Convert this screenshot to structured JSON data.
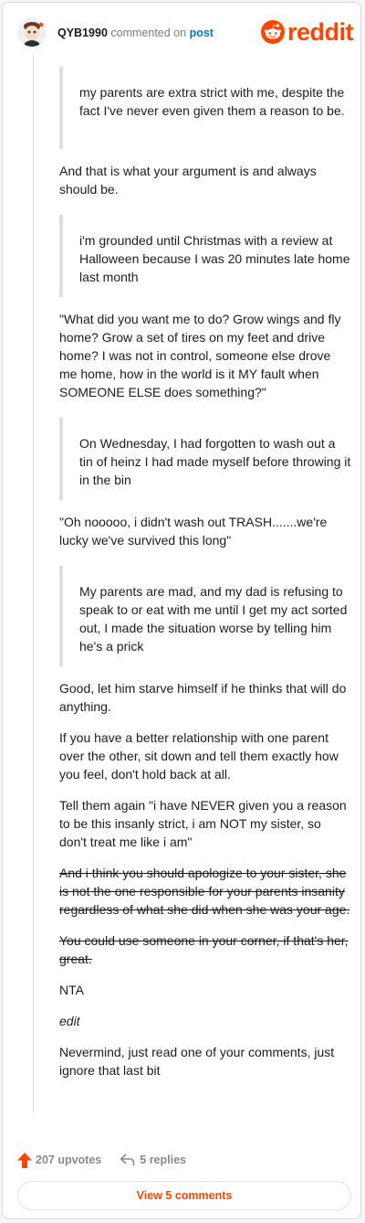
{
  "comment": {
    "username": "QYB1990",
    "commented_on": "commented on",
    "post_link": "post"
  },
  "brand": {
    "logo_text": "reddit",
    "accent": "#ff4500"
  },
  "body": {
    "quote1": "my parents are extra strict with me, despite the fact I've never even given them a reason to be.",
    "p1": "And that is what your argument is and always should be.",
    "quote2": "i'm grounded until Christmas with a review at Halloween because I was 20 minutes late home last month",
    "p2": "\"What did you want me to do? Grow wings and fly home? Grow a set of tires on my feet and drive home? I was not in control, someone else drove me home, how in the world is it MY fault when SOMEONE ELSE does something?\"",
    "quote3": "On Wednesday, I had forgotten to wash out a tin of heinz I had made myself before throwing it in the bin",
    "p3": "\"Oh nooooo, i didn't wash out TRASH.......we're lucky we've survived this long\"",
    "quote4": "My parents are mad, and my dad is refusing to speak to or eat with me until I get my act sorted out, I made the situation worse by telling him he's a prick",
    "p4": "Good, let him starve himself if he thinks that will do anything.",
    "p5": "If you have a better relationship with one parent over the other, sit down and tell them exactly how you feel, don't hold back at all.",
    "p6": "Tell them again \"i have NEVER given you a reason to be this insanly strict, i am NOT my sister, so don't treat me like i am\"",
    "p7_struck": "And i think you should apologize to your sister, she is not the one responsible for your parents insanity regardless of what she did when she was your age.",
    "p8_struck": "You could use someone in your corner, if that's her, great.",
    "p9": "NTA",
    "p10_italic": "edit",
    "p11": "Nevermind, just read one of your comments, just ignore that last bit"
  },
  "footer": {
    "upvotes": "207 upvotes",
    "replies": "5 replies",
    "view_comments": "View 5 comments"
  }
}
